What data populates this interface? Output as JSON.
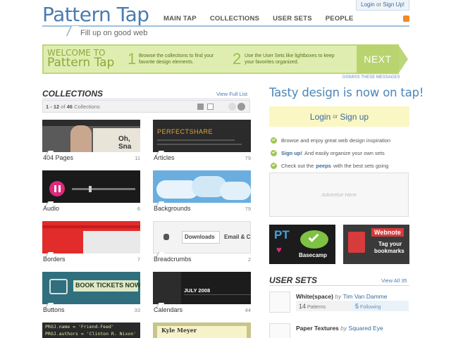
{
  "header": {
    "logo": "Pattern Tap",
    "tagline": "Fill up on good web",
    "nav": [
      "MAIN TAP",
      "COLLECTIONS",
      "USER SETS",
      "PEOPLE"
    ],
    "login": "Login",
    "or": "or",
    "signup": "Sign Up!"
  },
  "banner": {
    "welcome_line1": "WELCOME TO",
    "welcome_line2": "Pattern Tap",
    "step1_num": "1",
    "step1_text": "Browse the collections to find your favorite design elements.",
    "step2_num": "2",
    "step2_text": "Use the User Sets like lightboxes to keep your favorites organized.",
    "next": "NEXT",
    "dismiss": "DISMISS THESE MESSAGES"
  },
  "collections": {
    "title": "COLLECTIONS",
    "view_all": "View Full List",
    "range": "1 - 12",
    "of": "of",
    "total": "46",
    "total_label": "Collections",
    "items": [
      {
        "label": "404 Pages",
        "count": "11",
        "thumb_text": "Oh, Sna"
      },
      {
        "label": "Articles",
        "count": "79",
        "thumb_text": "PERFECTSHARE"
      },
      {
        "label": "Audio",
        "count": "6"
      },
      {
        "label": "Backgrounds",
        "count": "79"
      },
      {
        "label": "Borders",
        "count": "7"
      },
      {
        "label": "Breadcrumbs",
        "count": "2",
        "thumb_text": "Downloads",
        "thumb_text2": "Email & C"
      },
      {
        "label": "Buttons",
        "count": "33",
        "thumb_text": "BOOK TICKETS NOW"
      },
      {
        "label": "Calendars",
        "count": "44",
        "thumb_text": "JULY 2008"
      },
      {
        "code1": "PROJ.name = 'Friend-Feed'",
        "code2": "PROJ.authors = 'Clinton R. Nixon'"
      },
      {
        "thumb_text": "Kyle Meyer"
      }
    ]
  },
  "sidebar": {
    "hero": "Tasty design is now on tap!",
    "login": "Login",
    "or": "or",
    "signup": "Sign up",
    "bullets": [
      {
        "link": "",
        "text": "Browse and enjoy great web design inspiration"
      },
      {
        "link": "Sign up!",
        "text": "And easily organize your own sets"
      },
      {
        "pre": "Check out the",
        "link": "peeps",
        "text": "with the best sets going"
      }
    ],
    "ad": "Advertise Here",
    "promos": {
      "basecamp_pt": "PT",
      "basecamp_text": "Basecamp",
      "webnote_title": "Webnote",
      "webnote_line1": "Tag your",
      "webnote_line2": "bookmarks"
    }
  },
  "user_sets": {
    "title": "USER SETS",
    "view_all": "View All 35",
    "sets": [
      {
        "title": "White(space)",
        "by": "by",
        "author": "Tim Van Damme",
        "patterns": "14",
        "patterns_label": "Patterns",
        "following": "5",
        "following_label": "Following"
      },
      {
        "title": "Paper Textures",
        "by": "by",
        "author": "Squared Eye"
      }
    ]
  },
  "colors": {
    "accent": "#4a7cb0",
    "banner_green": "#dfeeb0",
    "login_box": "#fbf7c4"
  }
}
